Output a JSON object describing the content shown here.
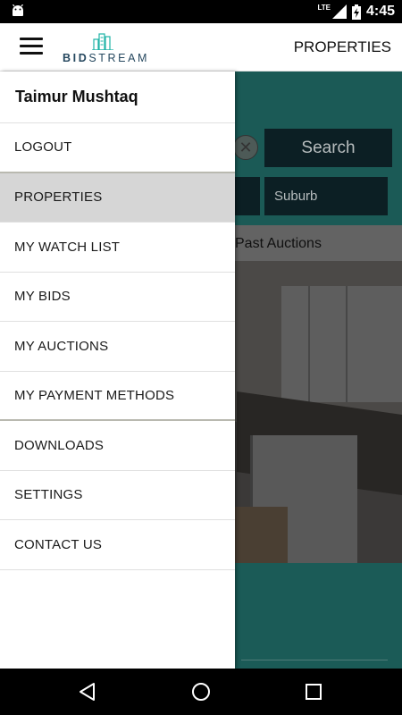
{
  "status_bar": {
    "network_label": "LTE",
    "time": "4:45",
    "icons": [
      "android-icon",
      "signal-icon",
      "battery-icon"
    ]
  },
  "app_bar": {
    "logo_text_bold": "BID",
    "logo_text_light": "STREAM",
    "title": "PROPERTIES",
    "brand_color": "#1fb3a7"
  },
  "background": {
    "search_button": "Search",
    "suburb_placeholder": "Suburb",
    "past_auctions_tab": "Past Auctions"
  },
  "drawer": {
    "user_name": "Taimur Mushtaq",
    "items": [
      {
        "label": "LOGOUT"
      },
      {
        "label": "PROPERTIES",
        "active": true
      },
      {
        "label": "MY WATCH LIST"
      },
      {
        "label": "MY BIDS"
      },
      {
        "label": "MY AUCTIONS"
      },
      {
        "label": "MY PAYMENT METHODS"
      },
      {
        "label": "DOWNLOADS"
      },
      {
        "label": "SETTINGS"
      },
      {
        "label": "CONTACT US"
      }
    ]
  },
  "nav_bar": {
    "icons": [
      "back-icon",
      "home-icon",
      "recents-icon"
    ]
  }
}
